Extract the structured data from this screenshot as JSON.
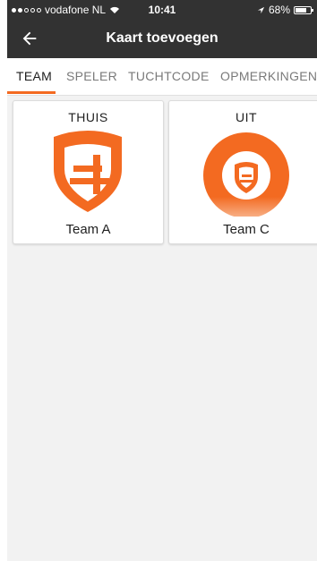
{
  "status_bar": {
    "carrier": "vodafone NL",
    "time": "10:41",
    "battery_percent": "68%"
  },
  "app_bar": {
    "title": "Kaart toevoegen",
    "back_icon": "arrow-left-icon"
  },
  "tabs": [
    {
      "label": "TEAM",
      "active": true
    },
    {
      "label": "SPELER",
      "active": false
    },
    {
      "label": "TUCHTCODE",
      "active": false
    },
    {
      "label": "OPMERKINGEN",
      "active": false
    }
  ],
  "teams": {
    "home": {
      "side_label": "THUIS",
      "name": "Team A",
      "logo_icon": "shield-logo-icon"
    },
    "away": {
      "side_label": "UIT",
      "name": "Team C",
      "logo_icon": "round-shield-logo-icon"
    }
  },
  "colors": {
    "accent": "#f36a21",
    "header_bg": "#323232",
    "background": "#f2f2f2"
  }
}
